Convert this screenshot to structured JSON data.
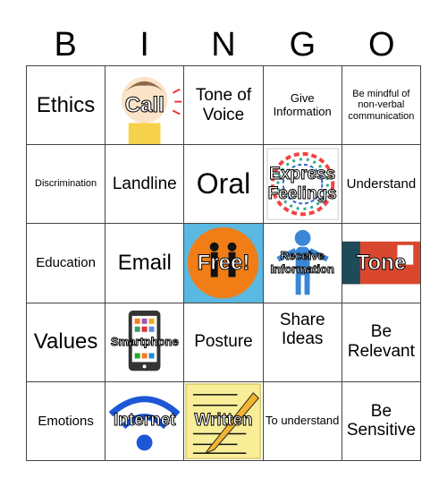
{
  "header": {
    "letters": [
      "B",
      "I",
      "N",
      "G",
      "O"
    ]
  },
  "cells": [
    [
      "Ethics",
      "Call",
      "Tone of Voice",
      "Give Information",
      "Be mindful of non-verbal communication"
    ],
    [
      "Discrimination",
      "Landline",
      "Oral",
      "Express Feelings",
      "Understand"
    ],
    [
      "Education",
      "Email",
      "Free!",
      "Receive Information",
      "Tone"
    ],
    [
      "Values",
      "Smartphone",
      "Posture",
      "Share Ideas",
      "Be Relevant"
    ],
    [
      "Emotions",
      "Internet",
      "Written",
      "To understand",
      "Be Sensitive"
    ]
  ],
  "colors": {
    "free_bg": "#5bb8e0",
    "free_circle": "#f07d16",
    "wifi": "#1d57d6",
    "note": "#f8ee98",
    "tone_bg": "#d9482e"
  }
}
